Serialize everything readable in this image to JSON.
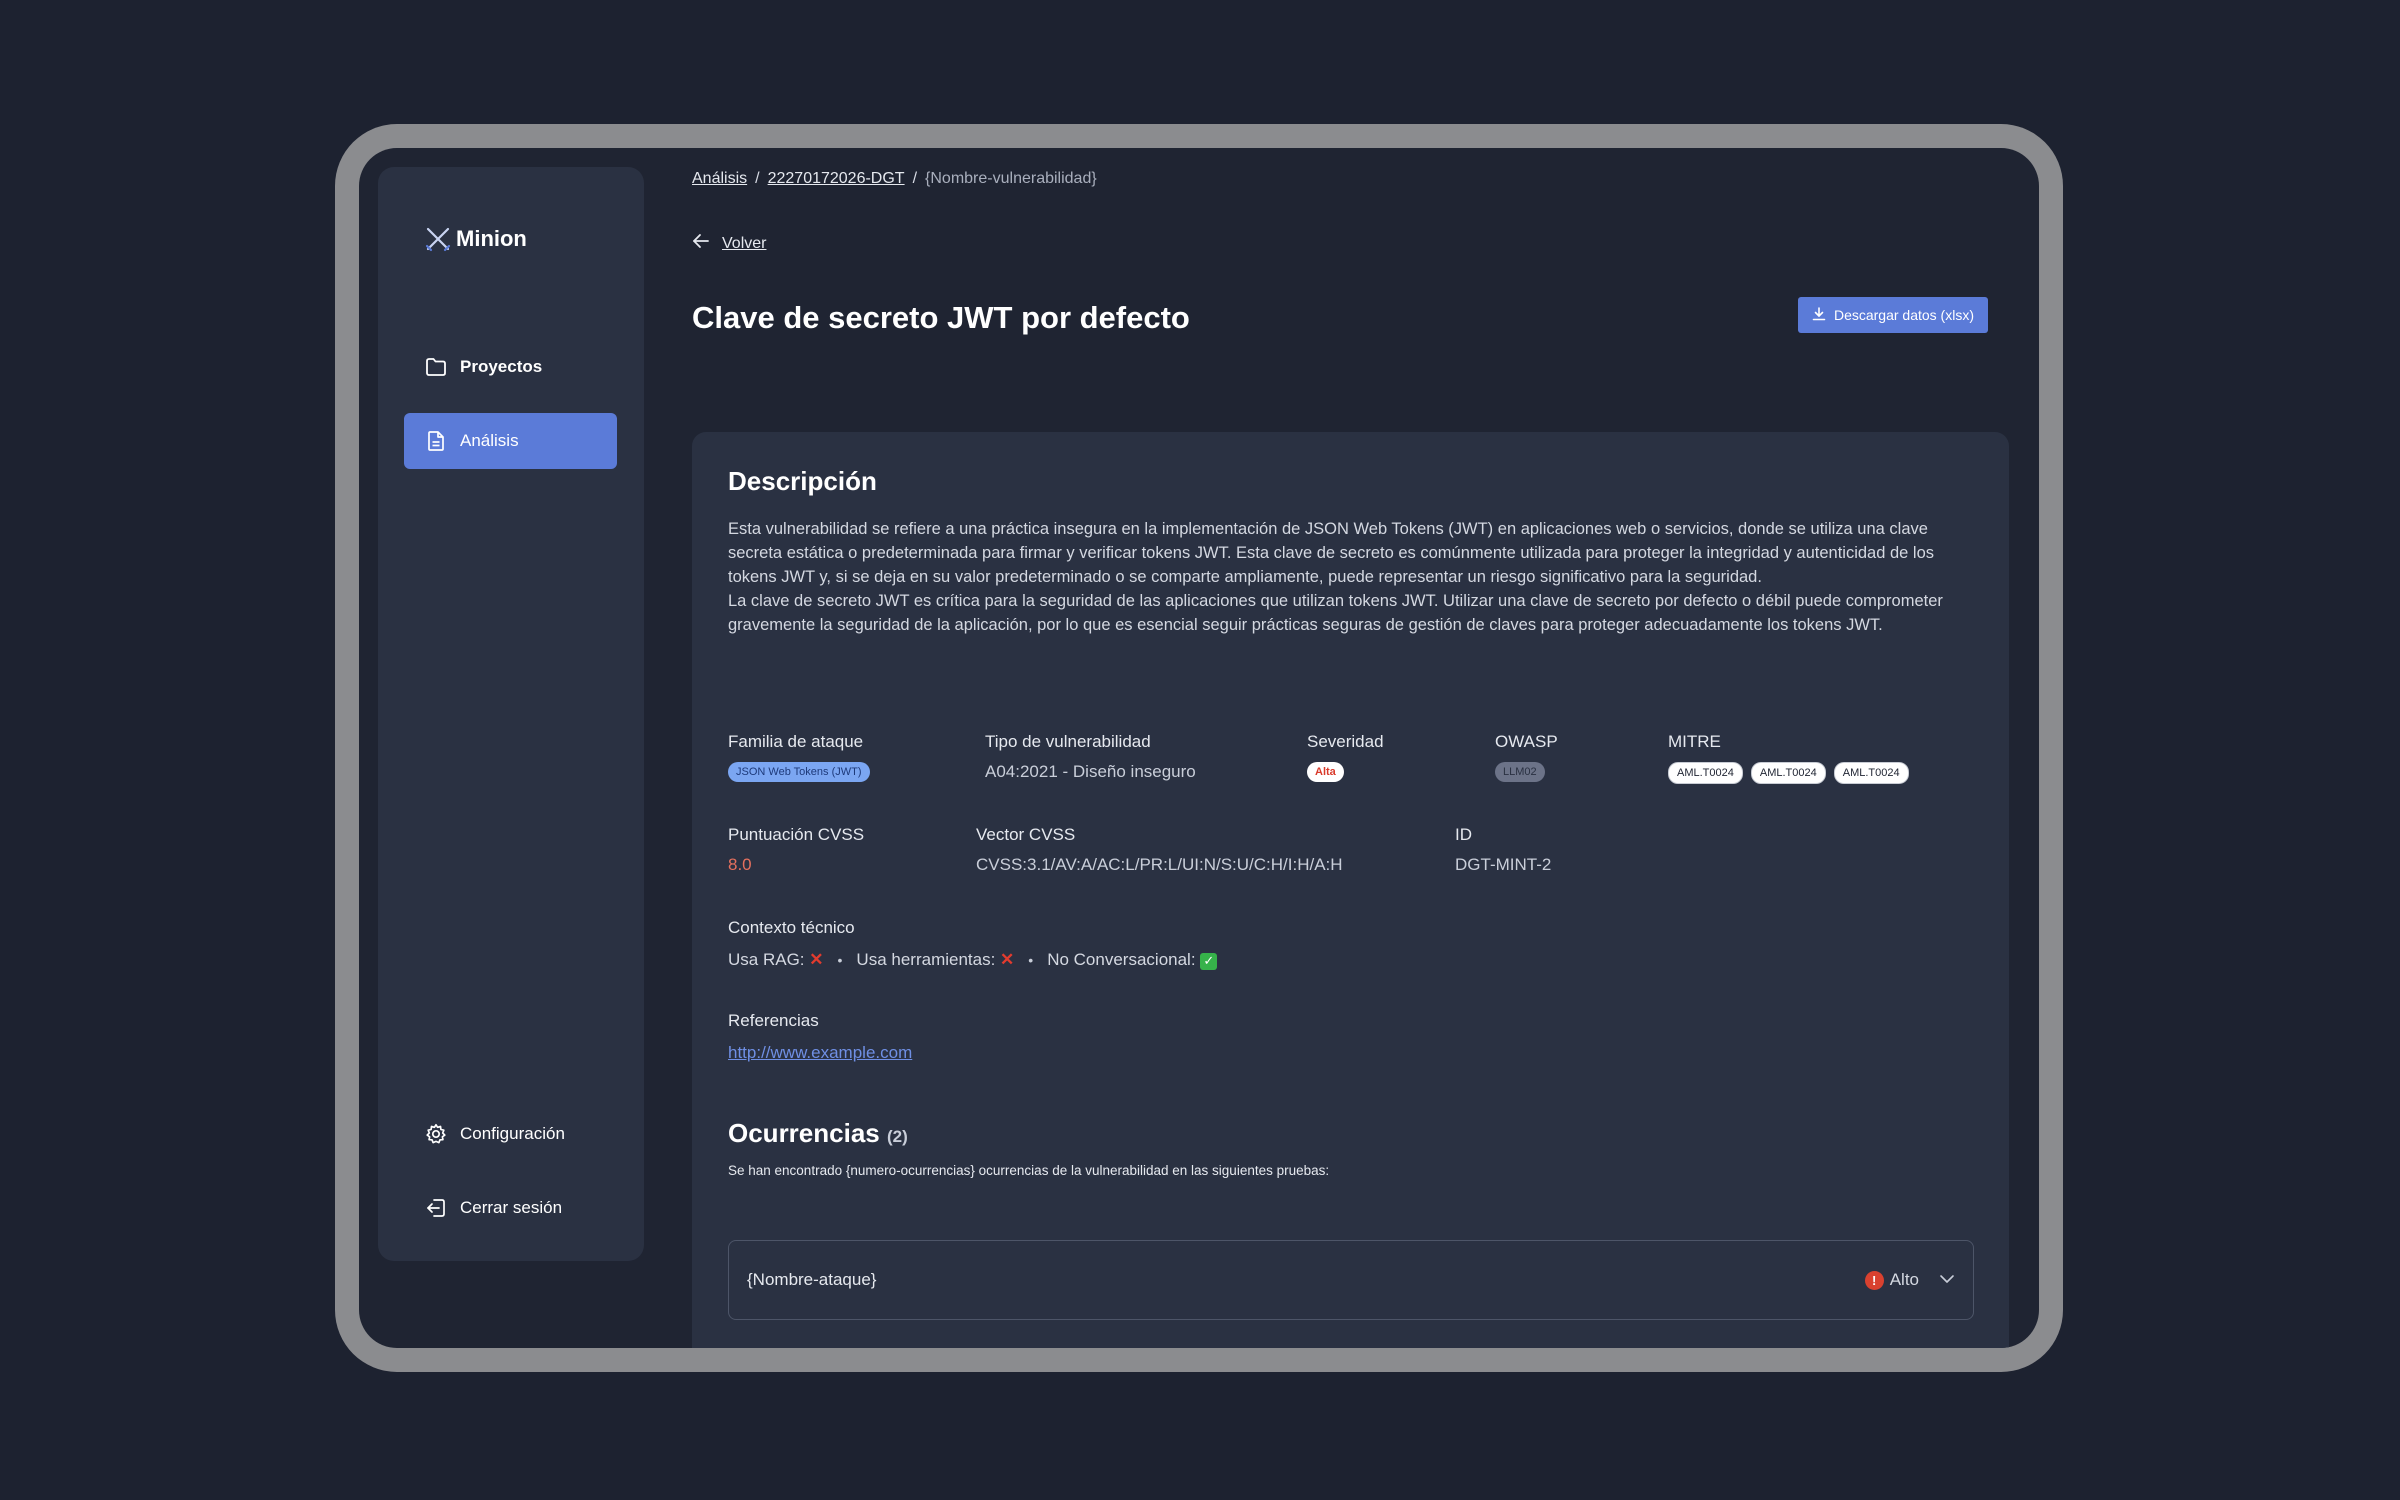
{
  "app": {
    "name": "Minion"
  },
  "sidebar": {
    "items": [
      {
        "label": "Proyectos",
        "icon": "folder-icon"
      },
      {
        "label": "Análisis",
        "icon": "document-icon"
      }
    ],
    "bottom_items": [
      {
        "label": "Configuración",
        "icon": "gear-icon"
      },
      {
        "label": "Cerrar sesión",
        "icon": "logout-icon"
      }
    ]
  },
  "breadcrumb": {
    "items": [
      "Análisis",
      "22270172026-DGT",
      "{Nombre-vulnerabilidad}"
    ],
    "separator": "/"
  },
  "back": {
    "label": "Volver"
  },
  "page": {
    "title": "Clave de secreto JWT por defecto",
    "download_label": "Descargar datos (xlsx)"
  },
  "description": {
    "heading": "Descripción",
    "paragraphs": [
      "Esta vulnerabilidad se refiere a una práctica insegura en la implementación de JSON Web Tokens (JWT) en aplicaciones web o servicios, donde se utiliza una clave secreta estática o predeterminada para firmar y verificar tokens JWT. Esta clave de secreto es comúnmente utilizada para proteger la integridad y autenticidad de los tokens JWT y, si se deja en su valor predeterminado o se comparte ampliamente, puede representar un riesgo significativo para la seguridad.",
      "La clave de secreto JWT es crítica para la seguridad de las aplicaciones que utilizan tokens JWT. Utilizar una clave de secreto por defecto o débil puede comprometer gravemente la seguridad de la aplicación, por lo que es esencial seguir prácticas seguras de gestión de claves para proteger adecuadamente los tokens JWT."
    ]
  },
  "fields": {
    "attack_family": {
      "label": "Familia de ataque",
      "value": "JSON Web Tokens (JWT)"
    },
    "vuln_type": {
      "label": "Tipo de vulnerabilidad",
      "value": "A04:2021 - Diseño inseguro"
    },
    "severity": {
      "label": "Severidad",
      "value": "Alta"
    },
    "owasp": {
      "label": "OWASP",
      "value": "LLM02"
    },
    "mitre": {
      "label": "MITRE",
      "values": [
        "AML.T0024",
        "AML.T0024",
        "AML.T0024"
      ]
    },
    "cvss_score": {
      "label": "Puntuación CVSS",
      "value": "8.0"
    },
    "cvss_vector": {
      "label": "Vector CVSS",
      "value": "CVSS:3.1/AV:A/AC:L/PR:L/UI:N/S:U/C:H/I:H/A:H"
    },
    "id": {
      "label": "ID",
      "value": "DGT-MINT-2"
    }
  },
  "technical_context": {
    "label": "Contexto técnico",
    "items": [
      {
        "label": "Usa RAG:",
        "status": "no"
      },
      {
        "label": "Usa herramientas:",
        "status": "no"
      },
      {
        "label": "No Conversacional:",
        "status": "yes"
      }
    ],
    "separator": "•"
  },
  "references": {
    "label": "Referencias",
    "link": "http://www.example.com"
  },
  "occurrences": {
    "heading": "Ocurrencias",
    "count": "(2)",
    "text": "Se han encontrado  {numero-ocurrencias} ocurrencias de la vulnerabilidad en las siguientes pruebas:",
    "items": [
      {
        "title": "{Nombre-ataque}",
        "severity": "Alto"
      }
    ]
  },
  "colors": {
    "background": "#1d2230",
    "panel": "#2a3142",
    "accent": "#5b7bd8",
    "danger": "#d9412f",
    "success": "#36b24a"
  }
}
